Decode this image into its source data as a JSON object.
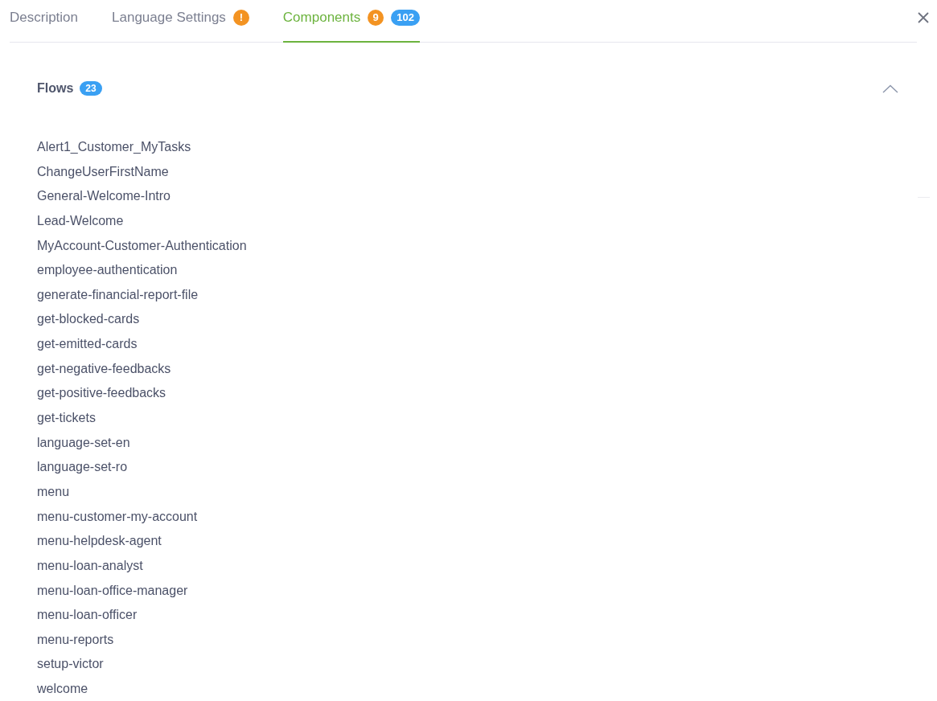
{
  "tabs": [
    {
      "label": "Description",
      "selected": false
    },
    {
      "label": "Language Settings",
      "selected": false,
      "badges": [
        {
          "text": "!",
          "color": "#f39322"
        }
      ]
    },
    {
      "label": "Components",
      "selected": true,
      "badges": [
        {
          "text": "9",
          "color": "#f39322"
        },
        {
          "text": "102",
          "color": "#3aa0f3"
        }
      ]
    }
  ],
  "section": {
    "title": "Flows",
    "count": "23",
    "expanded": true,
    "items": [
      "Alert1_Customer_MyTasks",
      "ChangeUserFirstName",
      "General-Welcome-Intro",
      "Lead-Welcome",
      "MyAccount-Customer-Authentication",
      "employee-authentication",
      "generate-financial-report-file",
      "get-blocked-cards",
      "get-emitted-cards",
      "get-negative-feedbacks",
      "get-positive-feedbacks",
      "get-tickets",
      "language-set-en",
      "language-set-ro",
      "menu",
      "menu-customer-my-account",
      "menu-helpdesk-agent",
      "menu-loan-analyst",
      "menu-loan-office-manager",
      "menu-loan-officer",
      "menu-reports",
      "setup-victor",
      "welcome"
    ]
  }
}
